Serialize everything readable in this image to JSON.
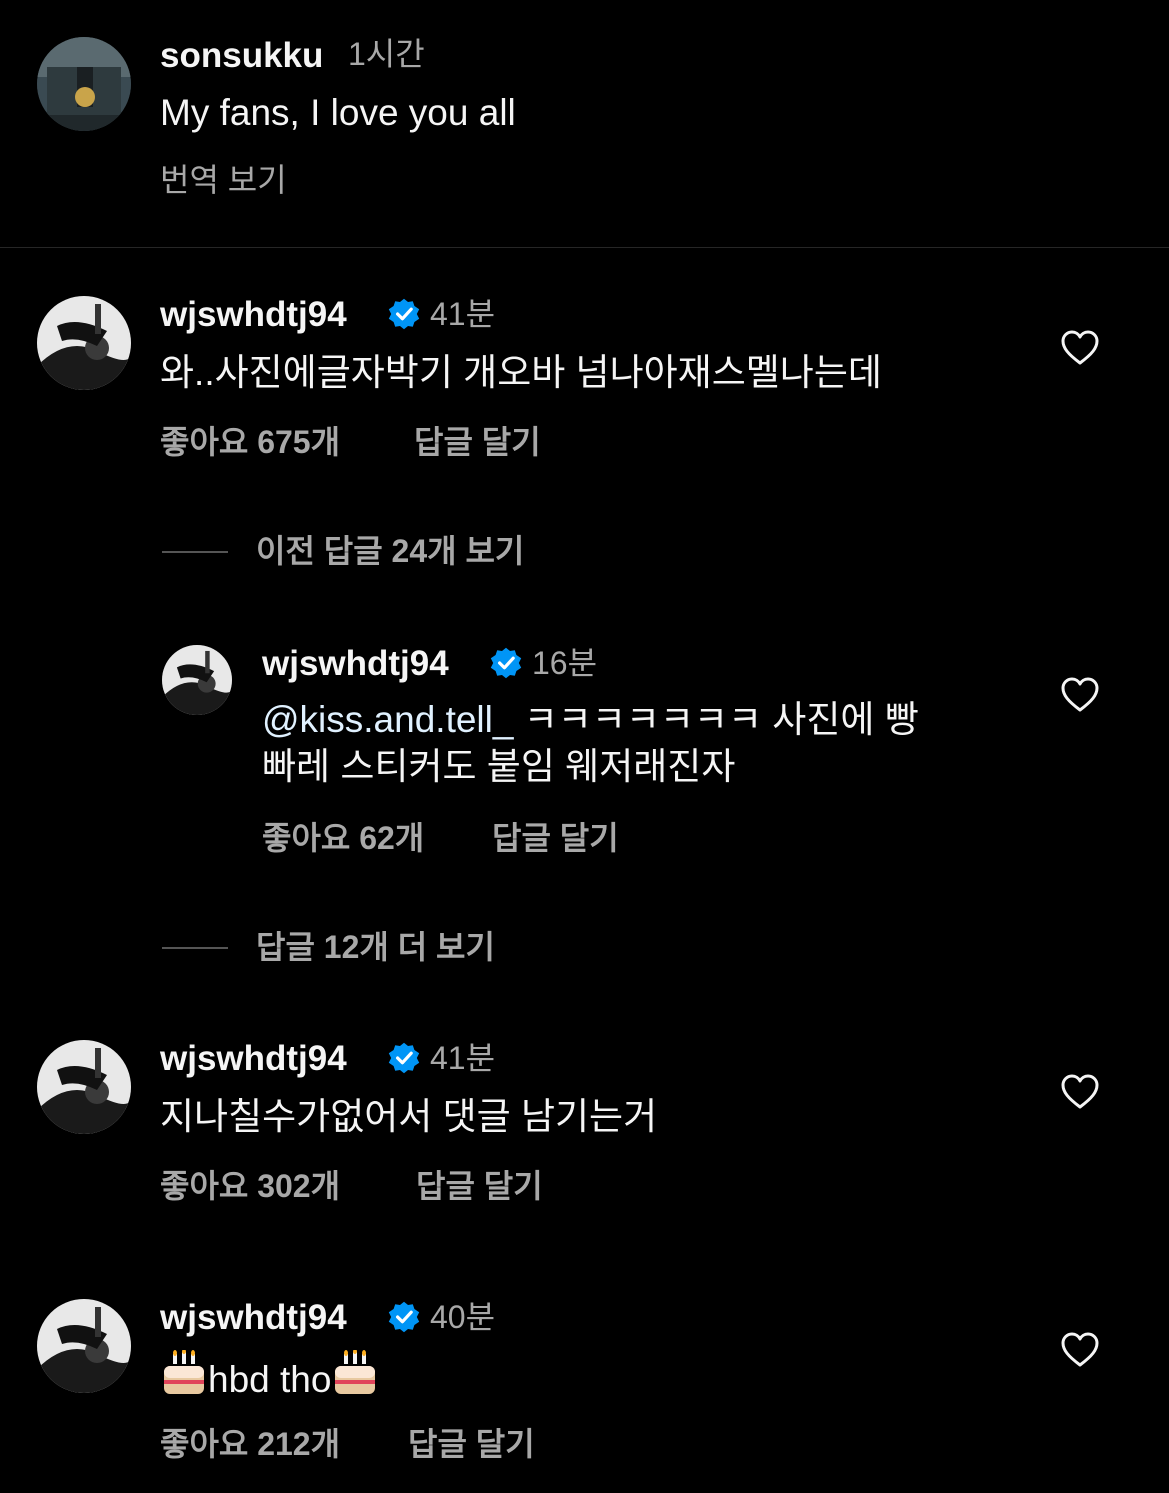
{
  "post": {
    "username": "sonsukku",
    "time": "1시간",
    "caption": "My fans, I love you all",
    "translate_label": "번역 보기"
  },
  "comments": [
    {
      "username": "wjswhdtj94",
      "time": "41분",
      "text": "와..사진에글자박기 개오바 넘나아재스멜나는데",
      "likes_label": "좋아요 675개",
      "reply_label": "답글 달기",
      "view_replies_label": "이전 답글 24개 보기",
      "reply": {
        "username": "wjswhdtj94",
        "time": "16분",
        "mention": "@kiss.and.tell_",
        "text_line1": " ㅋㅋㅋㅋㅋㅋㅋ 사진에 빵",
        "text_line2": "빠레 스티커도 붙임 웨저래진자",
        "likes_label": "좋아요 62개",
        "reply_label": "답글 달기"
      },
      "more_replies_label": "답글 12개 더 보기"
    },
    {
      "username": "wjswhdtj94",
      "time": "41분",
      "text": "지나칠수가없어서 댓글 남기는거",
      "likes_label": "좋아요 302개",
      "reply_label": "답글 달기"
    },
    {
      "username": "wjswhdtj94",
      "time": "40분",
      "text": "hbd tho",
      "text_emoji": "birthday-cake",
      "likes_label": "좋아요 212개",
      "reply_label": "답글 달기"
    }
  ],
  "colors": {
    "background": "#000000",
    "primary_text": "#f5f5f5",
    "secondary_text": "#a8a8a8",
    "verified_blue": "#0095f6",
    "mention": "#e0f1ff"
  }
}
